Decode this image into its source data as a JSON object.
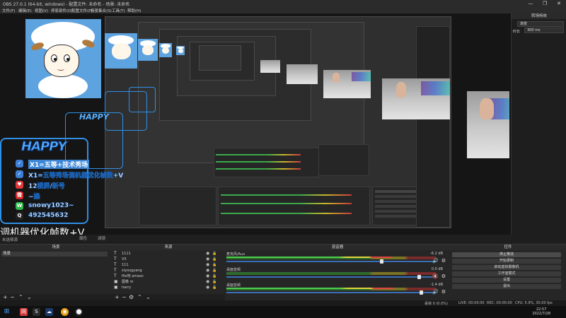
{
  "window": {
    "title": "OBS 27.0.1 (64-bit, windows) - 配置文件: 未命名 - 场景: 未命名",
    "controls": [
      "—",
      "❐",
      "✕"
    ]
  },
  "menu": [
    "文件(F)",
    "编辑(E)",
    "视图(V)",
    "停靠部件(D)",
    "配置文件(P)",
    "场景集合(S)",
    "工具(T)",
    "帮助(H)"
  ],
  "overlay": {
    "logo": "HAPPY",
    "rows": [
      {
        "icon": "✓",
        "text": "X1=五等+技术秀场"
      },
      {
        "icon": "✓",
        "text": "X1=五等秀场调机器优化帧数+V"
      },
      {
        "icon": "♥",
        "text": "12楼屏/新号"
      },
      {
        "icon": "微",
        "text": "~操"
      },
      {
        "icon": "W",
        "text": "snowy1023~"
      },
      {
        "icon": "Q",
        "text": "492545632"
      }
    ],
    "bottom_caption": "调机器优化帧数+V",
    "under_caption": "未选择源"
  },
  "subbar": {
    "left": "未选择源",
    "properties": "属性",
    "filters": "滤镜"
  },
  "scenes": {
    "title": "场景",
    "items": [
      "场景"
    ]
  },
  "sources": {
    "title": "来源",
    "items": [
      {
        "icon": "T",
        "name": "1111"
      },
      {
        "icon": "T",
        "name": "VX"
      },
      {
        "icon": "T",
        "name": "111"
      },
      {
        "icon": "T",
        "name": "siyougyang"
      },
      {
        "icon": "T",
        "name": "file地 amaoc"
      },
      {
        "icon": "▣",
        "name": "图像 m"
      },
      {
        "icon": "▣",
        "name": "harry"
      }
    ]
  },
  "mixer": {
    "title": "混音器",
    "channels": [
      {
        "name": "麦克风/Aux",
        "db": "-6.2 dB",
        "level": 0.79,
        "fader": 0.74,
        "muted": false
      },
      {
        "name": "桌面音频",
        "db": "0.0 dB",
        "level": 0.0,
        "fader": 0.92,
        "muted": true
      },
      {
        "name": "桌面音频",
        "db": "-1.4 dB",
        "level": 0.8,
        "fader": 0.93,
        "muted": false
      }
    ]
  },
  "controls": {
    "title": "控件",
    "buttons": [
      "停止推流",
      "开始录制",
      "启动虚拟摄像机",
      "工作室模式",
      "设置",
      "退出"
    ]
  },
  "transitions": {
    "title": "转场特效",
    "selected": "渐变",
    "duration_label": "时长",
    "duration": "300 ms"
  },
  "status": {
    "dropped": "丢帧 0 (0.0%)",
    "live": "LIVE: 00:00:00",
    "rec": "REC: 00:00:00",
    "cpu": "CPU: 5.9%, 30.00 fps"
  },
  "clock": {
    "time": "22:57",
    "date": "2022/7/28"
  },
  "taskbar_icons": [
    "⊞",
    "网",
    "S",
    "☁",
    "◉",
    "⬤"
  ]
}
